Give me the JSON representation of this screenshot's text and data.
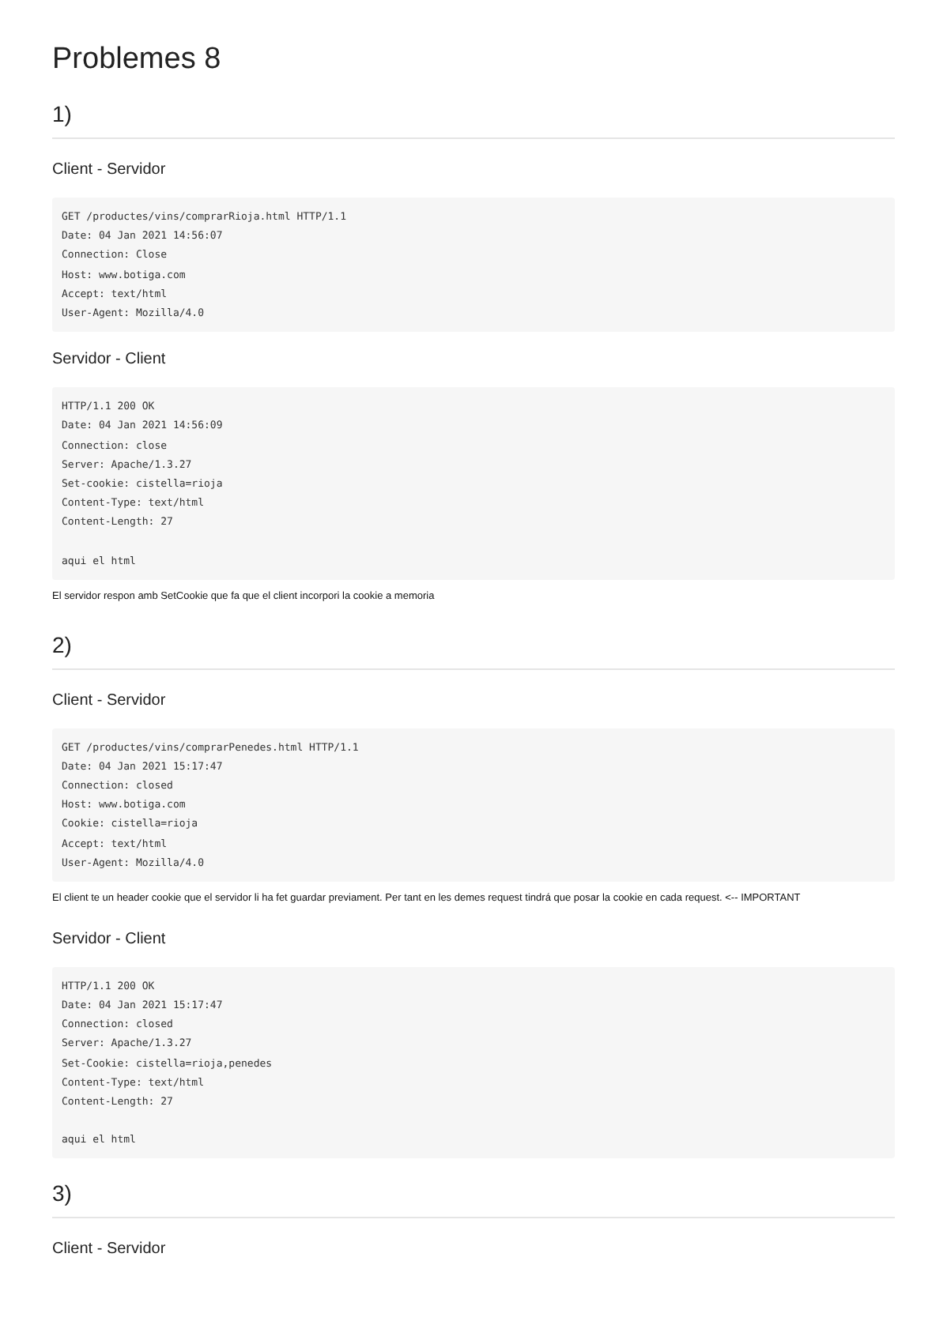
{
  "title": "Problemes 8",
  "sections": [
    {
      "heading": "1)",
      "blocks": [
        {
          "kind": "subheading",
          "text": "Client - Servidor"
        },
        {
          "kind": "code",
          "groups": [
            [
              "GET /productes/vins/comprarRioja.html HTTP/1.1",
              "Date: 04 Jan 2021 14:56:07",
              "Connection: Close",
              "Host: www.botiga.com",
              "Accept: text/html",
              "User-Agent: Mozilla/4.0"
            ]
          ]
        },
        {
          "kind": "subheading",
          "text": "Servidor - Client"
        },
        {
          "kind": "code",
          "groups": [
            [
              "HTTP/1.1 200 OK",
              "Date: 04 Jan 2021 14:56:09",
              "Connection: close",
              "Server: Apache/1.3.27",
              "Set-cookie: cistella=rioja",
              "Content-Type: text/html",
              "Content-Length: 27"
            ],
            [
              "aqui el html"
            ]
          ]
        },
        {
          "kind": "paragraph",
          "text": "El servidor respon amb SetCookie que fa que el client incorpori la cookie a memoria"
        }
      ]
    },
    {
      "heading": "2)",
      "blocks": [
        {
          "kind": "subheading",
          "text": "Client - Servidor"
        },
        {
          "kind": "code",
          "groups": [
            [
              "GET /productes/vins/comprarPenedes.html HTTP/1.1",
              "Date: 04 Jan 2021 15:17:47",
              "Connection: closed",
              "Host: www.botiga.com",
              "Cookie: cistella=rioja",
              "Accept: text/html",
              "User-Agent: Mozilla/4.0"
            ]
          ]
        },
        {
          "kind": "paragraph",
          "text": "El client te un header cookie que el servidor li ha fet guardar previament. Per tant en les demes request tindrá que posar la cookie en cada request. <-- IMPORTANT"
        },
        {
          "kind": "subheading",
          "text": "Servidor - Client"
        },
        {
          "kind": "code",
          "groups": [
            [
              "HTTP/1.1 200 OK",
              "Date: 04 Jan 2021 15:17:47",
              "Connection: closed",
              "Server: Apache/1.3.27",
              "Set-Cookie: cistella=rioja,penedes",
              "Content-Type: text/html",
              "Content-Length: 27"
            ],
            [
              "aqui el html"
            ]
          ]
        }
      ]
    },
    {
      "heading": "3)",
      "blocks": [
        {
          "kind": "subheading",
          "text": "Client - Servidor"
        }
      ]
    }
  ]
}
